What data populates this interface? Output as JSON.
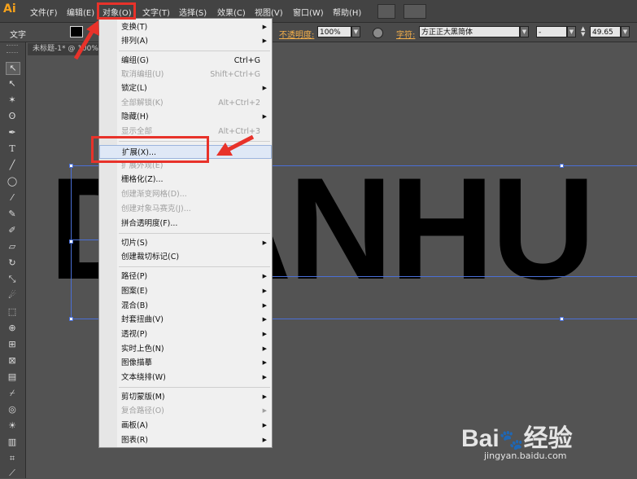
{
  "app": {
    "logo": "Ai"
  },
  "menubar": {
    "items": [
      "文件(F)",
      "编辑(E)",
      "对象(O)",
      "文字(T)",
      "选择(S)",
      "效果(C)",
      "视图(V)",
      "窗口(W)",
      "帮助(H)"
    ],
    "active": "对象(O)"
  },
  "control_bar": {
    "selection_type": "文字",
    "opacity_label": "不透明度:",
    "opacity_value": "100%",
    "font_label": "字符:",
    "font_value": "方正正大黑简体",
    "font_style": "-",
    "font_size": "49.65"
  },
  "doc_tab": {
    "title": "未标题-1* @ 100%"
  },
  "canvas": {
    "text": "DIANHU"
  },
  "object_menu": {
    "items": [
      {
        "label": "变换(T)",
        "shortcut": "",
        "submenu": true,
        "disabled": false
      },
      {
        "label": "排列(A)",
        "shortcut": "",
        "submenu": true,
        "disabled": false
      },
      {
        "label": "编组(G)",
        "shortcut": "Ctrl+G",
        "submenu": false,
        "disabled": false
      },
      {
        "label": "取消编组(U)",
        "shortcut": "Shift+Ctrl+G",
        "submenu": false,
        "disabled": true
      },
      {
        "label": "锁定(L)",
        "shortcut": "",
        "submenu": true,
        "disabled": false
      },
      {
        "label": "全部解锁(K)",
        "shortcut": "Alt+Ctrl+2",
        "submenu": false,
        "disabled": true
      },
      {
        "label": "隐藏(H)",
        "shortcut": "",
        "submenu": true,
        "disabled": false
      },
      {
        "label": "显示全部",
        "shortcut": "Alt+Ctrl+3",
        "submenu": false,
        "disabled": true
      },
      {
        "label": "扩展(X)...",
        "shortcut": "",
        "submenu": false,
        "disabled": false
      },
      {
        "label": "扩展外观(E)",
        "shortcut": "",
        "submenu": false,
        "disabled": true
      },
      {
        "label": "栅格化(Z)...",
        "shortcut": "",
        "submenu": false,
        "disabled": false
      },
      {
        "label": "创建渐变网格(D)...",
        "shortcut": "",
        "submenu": false,
        "disabled": true
      },
      {
        "label": "创建对象马赛克(J)...",
        "shortcut": "",
        "submenu": false,
        "disabled": true
      },
      {
        "label": "拼合透明度(F)...",
        "shortcut": "",
        "submenu": false,
        "disabled": false
      },
      {
        "label": "切片(S)",
        "shortcut": "",
        "submenu": true,
        "disabled": false
      },
      {
        "label": "创建裁切标记(C)",
        "shortcut": "",
        "submenu": false,
        "disabled": false
      },
      {
        "label": "路径(P)",
        "shortcut": "",
        "submenu": true,
        "disabled": false
      },
      {
        "label": "图案(E)",
        "shortcut": "",
        "submenu": true,
        "disabled": false
      },
      {
        "label": "混合(B)",
        "shortcut": "",
        "submenu": true,
        "disabled": false
      },
      {
        "label": "封套扭曲(V)",
        "shortcut": "",
        "submenu": true,
        "disabled": false
      },
      {
        "label": "透视(P)",
        "shortcut": "",
        "submenu": true,
        "disabled": false
      },
      {
        "label": "实时上色(N)",
        "shortcut": "",
        "submenu": true,
        "disabled": false
      },
      {
        "label": "图像描摹",
        "shortcut": "",
        "submenu": true,
        "disabled": false
      },
      {
        "label": "文本绕排(W)",
        "shortcut": "",
        "submenu": true,
        "disabled": false
      },
      {
        "label": "剪切蒙版(M)",
        "shortcut": "",
        "submenu": true,
        "disabled": false
      },
      {
        "label": "复合路径(O)",
        "shortcut": "",
        "submenu": true,
        "disabled": true
      },
      {
        "label": "画板(A)",
        "shortcut": "",
        "submenu": true,
        "disabled": false
      },
      {
        "label": "图表(R)",
        "shortcut": "",
        "submenu": true,
        "disabled": false
      }
    ]
  },
  "watermark": {
    "brand_left": "Bai",
    "brand_right": "经验",
    "url": "jingyan.baidu.com"
  },
  "colors": {
    "accent_red": "#e8322a",
    "selection_blue": "#4a6fd6",
    "logo_orange": "#f7a21b"
  }
}
